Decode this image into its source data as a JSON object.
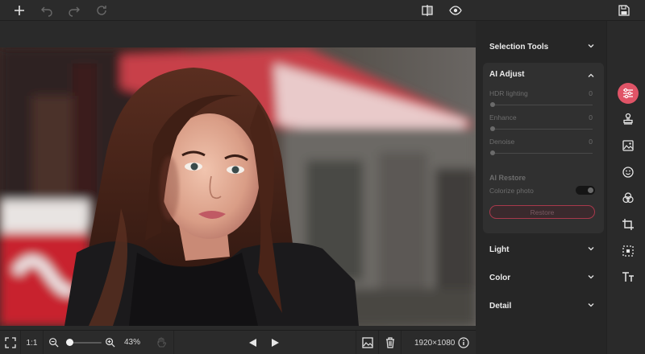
{
  "toolbar": {
    "icons": [
      "add-icon",
      "undo-icon",
      "redo-icon",
      "reset-icon",
      "compare-icon",
      "preview-eye-icon",
      "save-icon"
    ]
  },
  "panel": {
    "sections": {
      "selection_tools": "Selection Tools",
      "ai_adjust": "AI Adjust",
      "light": "Light",
      "color": "Color",
      "detail": "Detail"
    },
    "ai_adjust": {
      "sliders": [
        {
          "label": "HDR lighting",
          "value": "0"
        },
        {
          "label": "Enhance",
          "value": "0"
        },
        {
          "label": "Denoise",
          "value": "0"
        }
      ],
      "restore_heading": "AI Restore",
      "colorize_label": "Colorize photo",
      "colorize_on": false,
      "restore_button": "Restore"
    }
  },
  "tools": [
    "adjust-sliders-icon",
    "stamp-icon",
    "image-icon",
    "face-icon",
    "color-circles-icon",
    "crop-icon",
    "select-region-icon",
    "text-icon"
  ],
  "bottom": {
    "ratio": "1:1",
    "zoom": "43%",
    "dimensions": "1920×1080"
  },
  "colors": {
    "accent": "#e05467",
    "panel": "#262626",
    "card": "#303030"
  }
}
